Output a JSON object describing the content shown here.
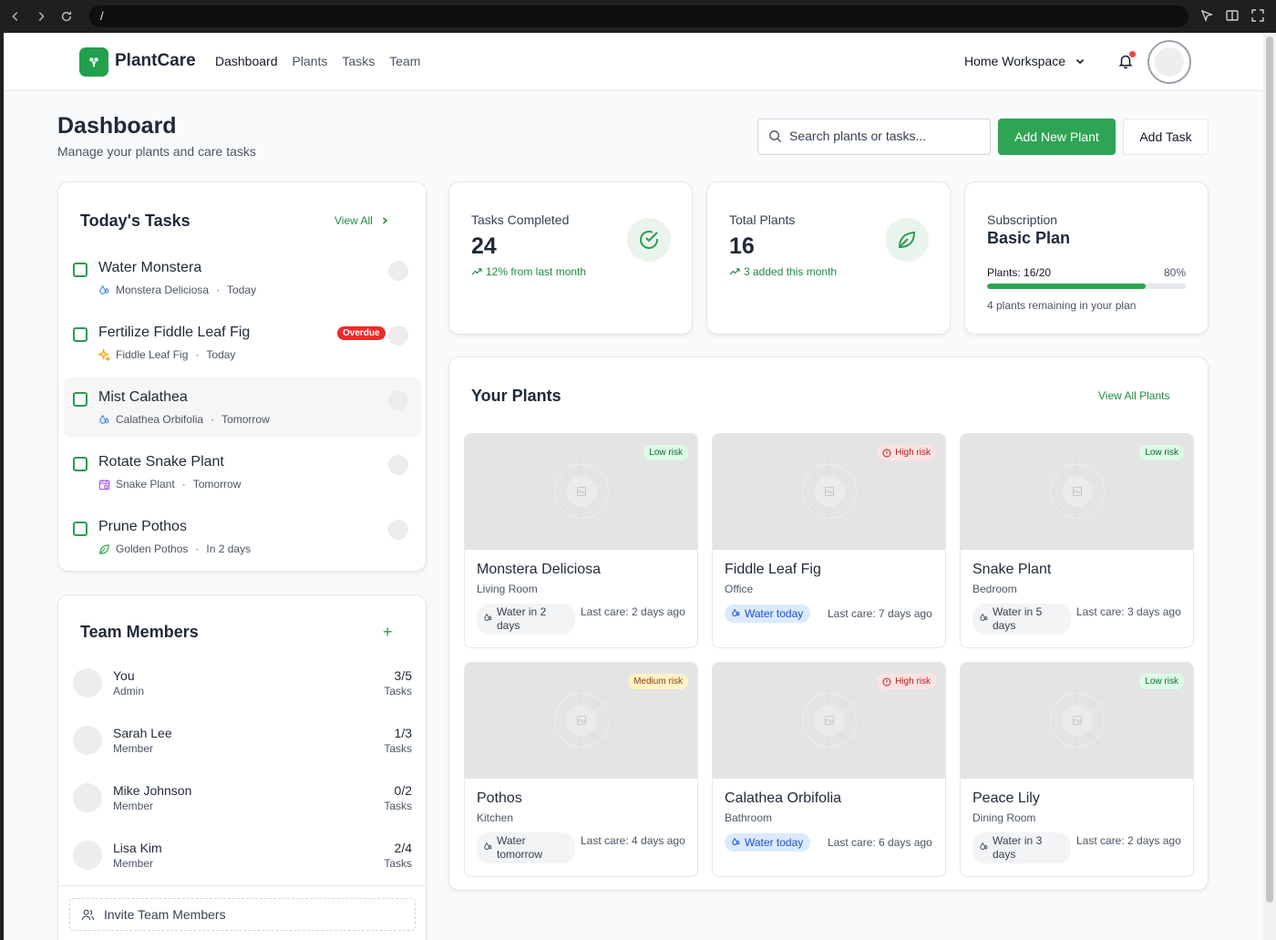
{
  "browser": {
    "url": "/"
  },
  "app": {
    "brand": "PlantCare",
    "accent": "#2ea455"
  },
  "nav": {
    "items": [
      "Dashboard",
      "Plants",
      "Tasks",
      "Team"
    ]
  },
  "header": {
    "workspace": "Home Workspace"
  },
  "page": {
    "title": "Dashboard",
    "subtitle": "Manage your plants and care tasks",
    "search_placeholder": "Search plants or tasks...",
    "add_plant": "Add New Plant",
    "add_task": "Add Task"
  },
  "tasks": {
    "title": "Today's Tasks",
    "view_all": "View All",
    "items": [
      {
        "name": "Water Monstera",
        "plant": "Monstera Deliciosa",
        "when": "Today",
        "icon": "water-icon"
      },
      {
        "name": "Fertilize Fiddle Leaf Fig",
        "plant": "Fiddle Leaf Fig",
        "when": "Today",
        "icon": "sparkle-icon",
        "badge": "Overdue"
      },
      {
        "name": "Mist Calathea",
        "plant": "Calathea Orbifolia",
        "when": "Tomorrow",
        "icon": "water-icon"
      },
      {
        "name": "Rotate Snake Plant",
        "plant": "Snake Plant",
        "when": "Tomorrow",
        "icon": "calendar-icon"
      },
      {
        "name": "Prune Pothos",
        "plant": "Golden Pothos",
        "when": "In 2 days",
        "icon": "leaf-icon"
      }
    ]
  },
  "team": {
    "title": "Team Members",
    "invite": "Invite Team Members",
    "members": [
      {
        "name": "You",
        "role": "Admin",
        "count": "3/5",
        "label": "Tasks"
      },
      {
        "name": "Sarah Lee",
        "role": "Member",
        "count": "1/3",
        "label": "Tasks"
      },
      {
        "name": "Mike Johnson",
        "role": "Member",
        "count": "0/2",
        "label": "Tasks"
      },
      {
        "name": "Lisa Kim",
        "role": "Member",
        "count": "2/4",
        "label": "Tasks"
      }
    ]
  },
  "stats": {
    "tasks_completed": {
      "label": "Tasks Completed",
      "value": "24",
      "trend": "12% from last month"
    },
    "total_plants": {
      "label": "Total Plants",
      "value": "16",
      "trend": "3 added this month"
    },
    "subscription": {
      "label": "Subscription",
      "plan": "Basic Plan",
      "plants": "Plants: 16/20",
      "percent": "80%",
      "progress": 0.8,
      "remaining": "4 plants remaining in your plan"
    }
  },
  "plants": {
    "title": "Your Plants",
    "view_all": "View All Plants",
    "items": [
      {
        "name": "Monstera Deliciosa",
        "location": "Living Room",
        "risk": "Low risk",
        "risk_level": "low",
        "water": "Water in 2 days",
        "last_care": "Last care: 2 days ago"
      },
      {
        "name": "Fiddle Leaf Fig",
        "location": "Office",
        "risk": "High risk",
        "risk_level": "high",
        "water": "Water today",
        "last_care": "Last care: 7 days ago"
      },
      {
        "name": "Snake Plant",
        "location": "Bedroom",
        "risk": "Low risk",
        "risk_level": "low",
        "water": "Water in 5 days",
        "last_care": "Last care: 3 days ago"
      },
      {
        "name": "Pothos",
        "location": "Kitchen",
        "risk": "Medium risk",
        "risk_level": "medium",
        "water": "Water tomorrow",
        "last_care": "Last care: 4 days ago"
      },
      {
        "name": "Calathea Orbifolia",
        "location": "Bathroom",
        "risk": "High risk",
        "risk_level": "high",
        "water": "Water today",
        "last_care": "Last care: 6 days ago"
      },
      {
        "name": "Peace Lily",
        "location": "Dining Room",
        "risk": "Low risk",
        "risk_level": "low",
        "water": "Water in 3 days",
        "last_care": "Last care: 2 days ago"
      }
    ]
  }
}
